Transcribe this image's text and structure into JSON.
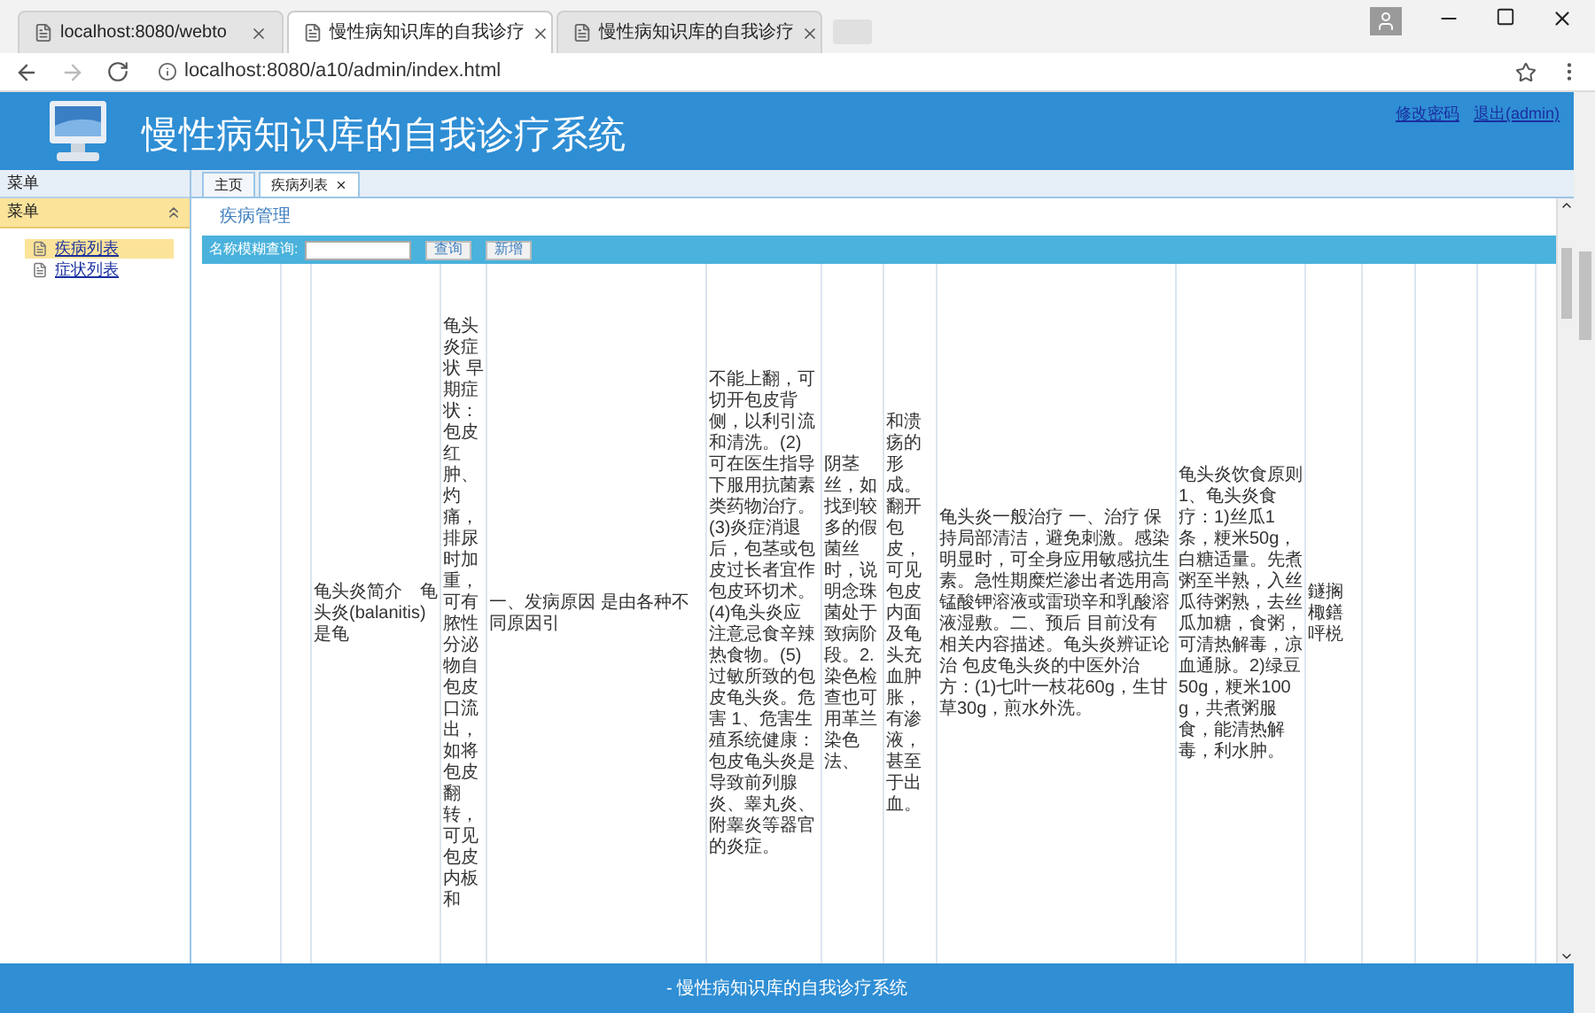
{
  "browser": {
    "tabs": [
      {
        "title": "localhost:8080/webto",
        "selected": false
      },
      {
        "title": "慢性病知识库的自我诊疗",
        "selected": true
      },
      {
        "title": "慢性病知识库的自我诊疗",
        "selected": false
      }
    ],
    "address": "localhost:8080/a10/admin/index.html"
  },
  "header": {
    "title": "慢性病知识库的自我诊疗系统",
    "links": [
      "修改密码",
      "退出(admin)"
    ]
  },
  "sidebar": {
    "title": "菜单",
    "panel": "菜单",
    "expanded": true,
    "items": [
      {
        "label": "疾病列表",
        "selected": true
      },
      {
        "label": "症状列表",
        "selected": false
      }
    ]
  },
  "tabs": [
    {
      "label": "主页",
      "closable": false,
      "selected": false
    },
    {
      "label": "疾病列表",
      "closable": true,
      "selected": true
    }
  ],
  "panel_title": "疾病管理",
  "search": {
    "label": "名称模糊查询:",
    "buttons": [
      "查询",
      "新增"
    ]
  },
  "table": {
    "rows": [
      {
        "cells": [
          "龟头炎简介　龟头炎(balanitis)是龟",
          "龟头炎症状 早期症状：包皮红肿、灼痛，排尿时加重，可有脓性分泌物自包皮口流出，如将包皮翻转，可见包皮内板和",
          "一、发病原因 是由各种不同原因引",
          "不能上翻，可切开包皮背侧，以利引流和清洗。(2)可在医生指导下服用抗菌素类药物治疗。(3)炎症消退后，包茎或包皮过长者宜作包皮环切术。(4)龟头炎应注意忌食辛辣热食物。(5)过敏所致的包皮龟头炎。危害 1、危害生殖系统健康：包皮龟头炎是导致前列腺炎、睾丸炎、附睾炎等器官的炎症。",
          "阴茎丝，如找到较多的假菌丝时，说明念珠菌处于致病阶段。2.染色检查也可用革兰染色法、",
          "和溃疡的形成。翻开包皮，可见包皮内面及龟头充血肿胀，有渗液，甚至于出血。",
          "龟头炎一般治疗 一、治疗 保持局部清洁，避免刺激。感染明显时，可全身应用敏感抗生素。急性期糜烂渗出者选用高锰酸钾溶液或雷琐辛和乳酸溶液湿敷。二、预后 目前没有相关内容描述。龟头炎辨证论治 包皮龟头炎的中医外治方：(1)七叶一枝花60g，生甘草30g，煎水外洗。",
          "龟头炎饮食原则 1、龟头炎食疗：1)丝瓜1条，粳米50g，白糖适量。先煮粥至半熟，入丝瓜待粥熟，去丝瓜加糖，食粥，可清热解毒，凉血通脉。2)绿豆50g，粳米100g，共煮粥服食，能清热解毒，利水肿。",
          "鐩搁棷鐥呯棁"
        ]
      }
    ]
  },
  "footer": "- 慢性病知识库的自我诊疗系统"
}
